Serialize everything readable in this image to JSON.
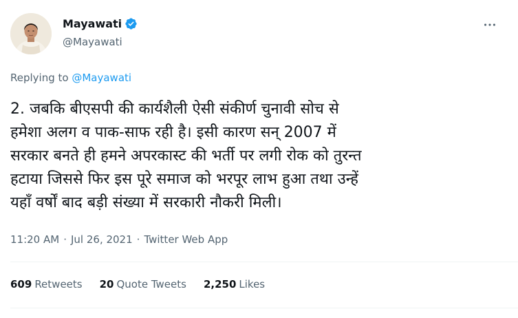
{
  "author": {
    "name": "Mayawati",
    "handle": "@Mayawati",
    "verified": true,
    "avatar_icon": "profile-photo"
  },
  "reply": {
    "prefix": "Replying to",
    "mention": "@Mayawati"
  },
  "body_lines": [
    "2. जबकि बीएसपी की कार्यशैली ऐसी संकीर्ण चुनावी सोच से",
    "हमेशा अलग व पाक-साफ रही है। इसी कारण सन् 2007 में",
    "सरकार बनते ही हमने अपरकास्ट की भर्ती पर लगी रोक को तुरन्त",
    "हटाया जिससे फिर इस पूरे समाज को भरपूर लाभ हुआ तथा उन्हें",
    "यहाँ वर्षों बाद बड़ी संख्या में सरकारी नौकरी मिली।"
  ],
  "meta": {
    "time": "11:20 AM",
    "date": "Jul 26, 2021",
    "source": "Twitter Web App",
    "separator": "·"
  },
  "stats": {
    "retweets_count": "609",
    "retweets_label": "Retweets",
    "quotes_count": "20",
    "quotes_label": "Quote Tweets",
    "likes_count": "2,250",
    "likes_label": "Likes"
  },
  "colors": {
    "text": "#0f1419",
    "secondary": "#536471",
    "link": "#1d9bf0",
    "verified": "#1d9bf0",
    "divider": "#eff3f4"
  }
}
